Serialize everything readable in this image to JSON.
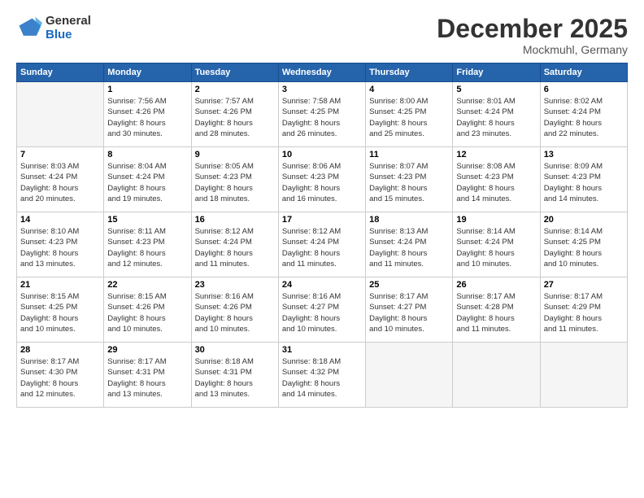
{
  "logo": {
    "line1": "General",
    "line2": "Blue"
  },
  "title": "December 2025",
  "location": "Mockmuhl, Germany",
  "days_header": [
    "Sunday",
    "Monday",
    "Tuesday",
    "Wednesday",
    "Thursday",
    "Friday",
    "Saturday"
  ],
  "weeks": [
    [
      {
        "day": "",
        "sunrise": "",
        "sunset": "",
        "daylight": ""
      },
      {
        "day": "1",
        "sunrise": "Sunrise: 7:56 AM",
        "sunset": "Sunset: 4:26 PM",
        "daylight": "Daylight: 8 hours and 30 minutes."
      },
      {
        "day": "2",
        "sunrise": "Sunrise: 7:57 AM",
        "sunset": "Sunset: 4:26 PM",
        "daylight": "Daylight: 8 hours and 28 minutes."
      },
      {
        "day": "3",
        "sunrise": "Sunrise: 7:58 AM",
        "sunset": "Sunset: 4:25 PM",
        "daylight": "Daylight: 8 hours and 26 minutes."
      },
      {
        "day": "4",
        "sunrise": "Sunrise: 8:00 AM",
        "sunset": "Sunset: 4:25 PM",
        "daylight": "Daylight: 8 hours and 25 minutes."
      },
      {
        "day": "5",
        "sunrise": "Sunrise: 8:01 AM",
        "sunset": "Sunset: 4:24 PM",
        "daylight": "Daylight: 8 hours and 23 minutes."
      },
      {
        "day": "6",
        "sunrise": "Sunrise: 8:02 AM",
        "sunset": "Sunset: 4:24 PM",
        "daylight": "Daylight: 8 hours and 22 minutes."
      }
    ],
    [
      {
        "day": "7",
        "sunrise": "Sunrise: 8:03 AM",
        "sunset": "Sunset: 4:24 PM",
        "daylight": "Daylight: 8 hours and 20 minutes."
      },
      {
        "day": "8",
        "sunrise": "Sunrise: 8:04 AM",
        "sunset": "Sunset: 4:24 PM",
        "daylight": "Daylight: 8 hours and 19 minutes."
      },
      {
        "day": "9",
        "sunrise": "Sunrise: 8:05 AM",
        "sunset": "Sunset: 4:23 PM",
        "daylight": "Daylight: 8 hours and 18 minutes."
      },
      {
        "day": "10",
        "sunrise": "Sunrise: 8:06 AM",
        "sunset": "Sunset: 4:23 PM",
        "daylight": "Daylight: 8 hours and 16 minutes."
      },
      {
        "day": "11",
        "sunrise": "Sunrise: 8:07 AM",
        "sunset": "Sunset: 4:23 PM",
        "daylight": "Daylight: 8 hours and 15 minutes."
      },
      {
        "day": "12",
        "sunrise": "Sunrise: 8:08 AM",
        "sunset": "Sunset: 4:23 PM",
        "daylight": "Daylight: 8 hours and 14 minutes."
      },
      {
        "day": "13",
        "sunrise": "Sunrise: 8:09 AM",
        "sunset": "Sunset: 4:23 PM",
        "daylight": "Daylight: 8 hours and 14 minutes."
      }
    ],
    [
      {
        "day": "14",
        "sunrise": "Sunrise: 8:10 AM",
        "sunset": "Sunset: 4:23 PM",
        "daylight": "Daylight: 8 hours and 13 minutes."
      },
      {
        "day": "15",
        "sunrise": "Sunrise: 8:11 AM",
        "sunset": "Sunset: 4:23 PM",
        "daylight": "Daylight: 8 hours and 12 minutes."
      },
      {
        "day": "16",
        "sunrise": "Sunrise: 8:12 AM",
        "sunset": "Sunset: 4:24 PM",
        "daylight": "Daylight: 8 hours and 11 minutes."
      },
      {
        "day": "17",
        "sunrise": "Sunrise: 8:12 AM",
        "sunset": "Sunset: 4:24 PM",
        "daylight": "Daylight: 8 hours and 11 minutes."
      },
      {
        "day": "18",
        "sunrise": "Sunrise: 8:13 AM",
        "sunset": "Sunset: 4:24 PM",
        "daylight": "Daylight: 8 hours and 11 minutes."
      },
      {
        "day": "19",
        "sunrise": "Sunrise: 8:14 AM",
        "sunset": "Sunset: 4:24 PM",
        "daylight": "Daylight: 8 hours and 10 minutes."
      },
      {
        "day": "20",
        "sunrise": "Sunrise: 8:14 AM",
        "sunset": "Sunset: 4:25 PM",
        "daylight": "Daylight: 8 hours and 10 minutes."
      }
    ],
    [
      {
        "day": "21",
        "sunrise": "Sunrise: 8:15 AM",
        "sunset": "Sunset: 4:25 PM",
        "daylight": "Daylight: 8 hours and 10 minutes."
      },
      {
        "day": "22",
        "sunrise": "Sunrise: 8:15 AM",
        "sunset": "Sunset: 4:26 PM",
        "daylight": "Daylight: 8 hours and 10 minutes."
      },
      {
        "day": "23",
        "sunrise": "Sunrise: 8:16 AM",
        "sunset": "Sunset: 4:26 PM",
        "daylight": "Daylight: 8 hours and 10 minutes."
      },
      {
        "day": "24",
        "sunrise": "Sunrise: 8:16 AM",
        "sunset": "Sunset: 4:27 PM",
        "daylight": "Daylight: 8 hours and 10 minutes."
      },
      {
        "day": "25",
        "sunrise": "Sunrise: 8:17 AM",
        "sunset": "Sunset: 4:27 PM",
        "daylight": "Daylight: 8 hours and 10 minutes."
      },
      {
        "day": "26",
        "sunrise": "Sunrise: 8:17 AM",
        "sunset": "Sunset: 4:28 PM",
        "daylight": "Daylight: 8 hours and 11 minutes."
      },
      {
        "day": "27",
        "sunrise": "Sunrise: 8:17 AM",
        "sunset": "Sunset: 4:29 PM",
        "daylight": "Daylight: 8 hours and 11 minutes."
      }
    ],
    [
      {
        "day": "28",
        "sunrise": "Sunrise: 8:17 AM",
        "sunset": "Sunset: 4:30 PM",
        "daylight": "Daylight: 8 hours and 12 minutes."
      },
      {
        "day": "29",
        "sunrise": "Sunrise: 8:17 AM",
        "sunset": "Sunset: 4:31 PM",
        "daylight": "Daylight: 8 hours and 13 minutes."
      },
      {
        "day": "30",
        "sunrise": "Sunrise: 8:18 AM",
        "sunset": "Sunset: 4:31 PM",
        "daylight": "Daylight: 8 hours and 13 minutes."
      },
      {
        "day": "31",
        "sunrise": "Sunrise: 8:18 AM",
        "sunset": "Sunset: 4:32 PM",
        "daylight": "Daylight: 8 hours and 14 minutes."
      },
      {
        "day": "",
        "sunrise": "",
        "sunset": "",
        "daylight": ""
      },
      {
        "day": "",
        "sunrise": "",
        "sunset": "",
        "daylight": ""
      },
      {
        "day": "",
        "sunrise": "",
        "sunset": "",
        "daylight": ""
      }
    ]
  ]
}
